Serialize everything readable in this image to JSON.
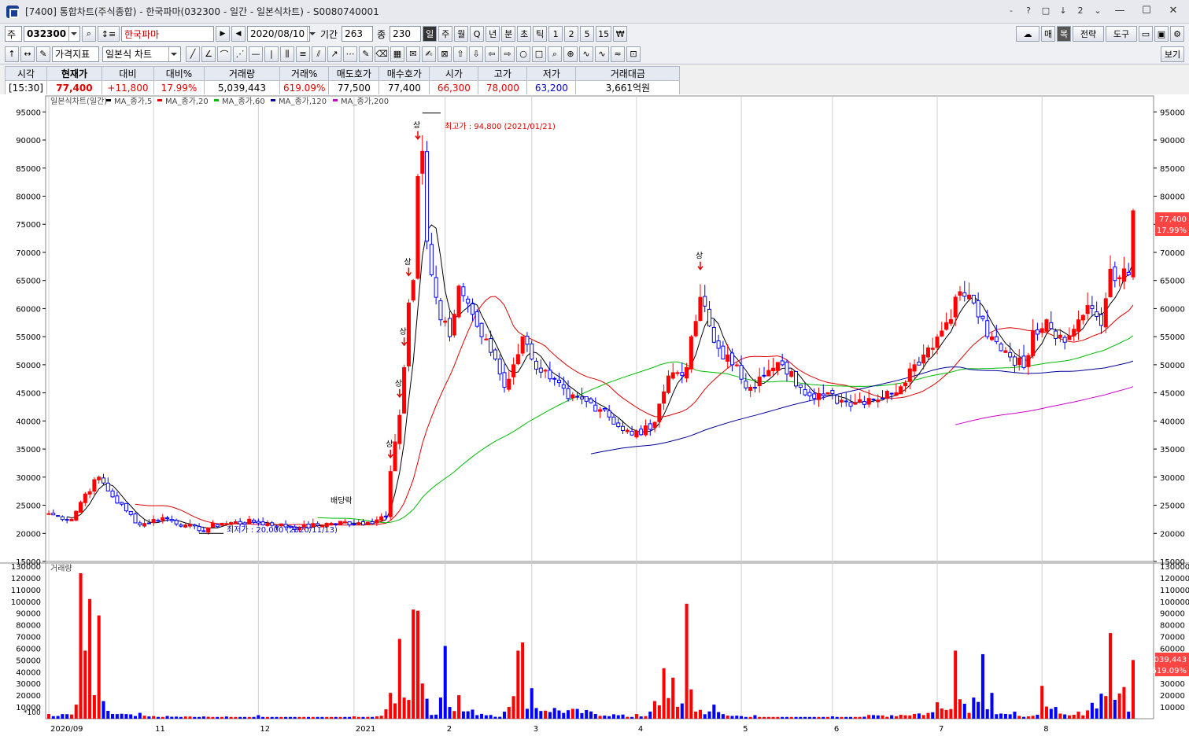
{
  "window": {
    "title": "[7400] 통합차트(주식종합) - 한국파마(032300 - 일간 - 일본식차트) - S0080740001",
    "controls": [
      "-",
      "?",
      "□",
      "↓",
      "2",
      "⌄"
    ]
  },
  "toolbar1": {
    "market": "주",
    "code": "032300",
    "name": "한국파마",
    "date": "2020/08/10",
    "period_label": "기간",
    "period": "263",
    "count_label": "종",
    "count": "230",
    "intervals": [
      "일",
      "주",
      "월",
      "Q",
      "년",
      "분",
      "초",
      "틱",
      "1",
      "2",
      "5",
      "15",
      "₩"
    ],
    "right": [
      "매",
      "복",
      "전략",
      "도구"
    ]
  },
  "toolbar2": {
    "indicator": "가격지표",
    "chart_type": "일본식 차트",
    "view_btn": "보기"
  },
  "info": {
    "headers": [
      "시각",
      "현재가",
      "대비",
      "대비%",
      "거래량",
      "거래%",
      "매도호가",
      "매수호가",
      "시가",
      "고가",
      "저가",
      "거래대금"
    ],
    "values": [
      "[15:30]",
      "77,400",
      "+11,800",
      "17.99%",
      "5,039,443",
      "619.09%",
      "77,500",
      "77,400",
      "66,300",
      "78,000",
      "63,200",
      "3,661억원"
    ],
    "value_colors": [
      "#000",
      "#e00000",
      "#e00000",
      "#e00000",
      "#000",
      "#e00000",
      "#000",
      "#000",
      "#e00000",
      "#e00000",
      "#0000cc",
      "#000"
    ]
  },
  "legend": {
    "chart": "일본식차트(일간)",
    "ma": [
      "MA_종가,5",
      "MA_종가,20",
      "MA_종가,60",
      "MA_종가,120",
      "MA_종가,200"
    ],
    "ma_colors": [
      "#000000",
      "#dd0000",
      "#00bb00",
      "#000099",
      "#cc00cc"
    ],
    "volume": "거래량"
  },
  "annotations": {
    "high": "최고가 : 94,800 (2021/01/21)",
    "low": "최저가 : 20,000 (2020/11/13)",
    "dividend": "배당락",
    "limit_up": "상"
  },
  "price_box": {
    "value": "77,400",
    "pct": "17.99%"
  },
  "volume_box": {
    "value": "5,039,443",
    "pct": "619.09%"
  },
  "volume_unit": "*100",
  "chart_data": {
    "type": "candlestick",
    "ylim": [
      15000,
      97000
    ],
    "yticks": [
      15000,
      20000,
      25000,
      30000,
      35000,
      40000,
      45000,
      50000,
      55000,
      60000,
      65000,
      70000,
      75000,
      80000,
      85000,
      90000,
      95000
    ],
    "volume_ylim": [
      0,
      130000
    ],
    "volume_yticks": [
      10000,
      20000,
      30000,
      40000,
      50000,
      60000,
      70000,
      80000,
      90000,
      100000,
      110000,
      120000,
      130000
    ],
    "xlabels": [
      {
        "i": 0,
        "label": "2020/09"
      },
      {
        "i": 23,
        "label": "11"
      },
      {
        "i": 46,
        "label": "12"
      },
      {
        "i": 67,
        "label": "2021"
      },
      {
        "i": 87,
        "label": "2"
      },
      {
        "i": 106,
        "label": "3"
      },
      {
        "i": 129,
        "label": "4"
      },
      {
        "i": 152,
        "label": "5"
      },
      {
        "i": 172,
        "label": "6"
      },
      {
        "i": 195,
        "label": "7"
      },
      {
        "i": 218,
        "label": "8"
      }
    ],
    "close_anchors": [
      [
        0,
        23500
      ],
      [
        5,
        22500
      ],
      [
        8,
        27000
      ],
      [
        11,
        30000
      ],
      [
        14,
        26500
      ],
      [
        17,
        24000
      ],
      [
        20,
        21500
      ],
      [
        25,
        22800
      ],
      [
        30,
        21500
      ],
      [
        33,
        20500
      ],
      [
        38,
        21800
      ],
      [
        45,
        22000
      ],
      [
        55,
        21000
      ],
      [
        62,
        21800
      ],
      [
        70,
        22000
      ],
      [
        74,
        23000
      ],
      [
        75,
        31000
      ],
      [
        77,
        41000
      ],
      [
        78,
        49500
      ],
      [
        79,
        61000
      ],
      [
        80,
        65000
      ],
      [
        81,
        83500
      ],
      [
        82,
        88000
      ],
      [
        83,
        72000
      ],
      [
        84,
        66000
      ],
      [
        85,
        62000
      ],
      [
        86,
        58000
      ],
      [
        88,
        55000
      ],
      [
        90,
        64000
      ],
      [
        92,
        61000
      ],
      [
        95,
        55000
      ],
      [
        98,
        51000
      ],
      [
        100,
        46000
      ],
      [
        102,
        50000
      ],
      [
        104,
        55000
      ],
      [
        106,
        51000
      ],
      [
        110,
        47500
      ],
      [
        114,
        44000
      ],
      [
        118,
        43500
      ],
      [
        122,
        42000
      ],
      [
        125,
        39000
      ],
      [
        128,
        37500
      ],
      [
        132,
        38500
      ],
      [
        134,
        43000
      ],
      [
        136,
        48000
      ],
      [
        140,
        49500
      ],
      [
        143,
        62000
      ],
      [
        146,
        54000
      ],
      [
        150,
        50000
      ],
      [
        154,
        46000
      ],
      [
        157,
        48000
      ],
      [
        161,
        50000
      ],
      [
        165,
        46000
      ],
      [
        170,
        44500
      ],
      [
        175,
        43500
      ],
      [
        180,
        44000
      ],
      [
        185,
        44800
      ],
      [
        190,
        50000
      ],
      [
        193,
        53000
      ],
      [
        196,
        56000
      ],
      [
        200,
        63000
      ],
      [
        203,
        61000
      ],
      [
        206,
        55000
      ],
      [
        210,
        52500
      ],
      [
        214,
        49500
      ],
      [
        216,
        56000
      ],
      [
        219,
        58000
      ],
      [
        223,
        54000
      ],
      [
        226,
        58000
      ],
      [
        229,
        60000
      ],
      [
        231,
        57000
      ],
      [
        233,
        67000
      ],
      [
        235,
        65500
      ],
      [
        237,
        66000
      ],
      [
        238,
        77400
      ]
    ],
    "volume_anchors": [
      [
        0,
        4000
      ],
      [
        6,
        12000
      ],
      [
        7,
        124000
      ],
      [
        9,
        102000
      ],
      [
        10,
        20000
      ],
      [
        11,
        88000
      ],
      [
        12,
        15000
      ],
      [
        20,
        5000
      ],
      [
        46,
        3000
      ],
      [
        67,
        2000
      ],
      [
        74,
        8000
      ],
      [
        75,
        22000
      ],
      [
        77,
        68000
      ],
      [
        78,
        18000
      ],
      [
        79,
        16000
      ],
      [
        80,
        93000
      ],
      [
        81,
        92000
      ],
      [
        82,
        30000
      ],
      [
        83,
        17000
      ],
      [
        86,
        18000
      ],
      [
        87,
        62000
      ],
      [
        88,
        10000
      ],
      [
        90,
        20000
      ],
      [
        100,
        6000
      ],
      [
        103,
        58000
      ],
      [
        104,
        65000
      ],
      [
        106,
        26000
      ],
      [
        129,
        4000
      ],
      [
        133,
        15000
      ],
      [
        135,
        43000
      ],
      [
        137,
        35000
      ],
      [
        139,
        13000
      ],
      [
        140,
        98000
      ],
      [
        141,
        25000
      ],
      [
        146,
        12000
      ],
      [
        155,
        3000
      ],
      [
        172,
        2000
      ],
      [
        195,
        14000
      ],
      [
        199,
        58000
      ],
      [
        203,
        18000
      ],
      [
        205,
        55000
      ],
      [
        207,
        22000
      ],
      [
        212,
        6000
      ],
      [
        215,
        2000
      ],
      [
        218,
        28000
      ],
      [
        221,
        10000
      ],
      [
        226,
        6000
      ],
      [
        233,
        73000
      ],
      [
        236,
        27000
      ],
      [
        237,
        6000
      ],
      [
        238,
        50000
      ]
    ]
  }
}
